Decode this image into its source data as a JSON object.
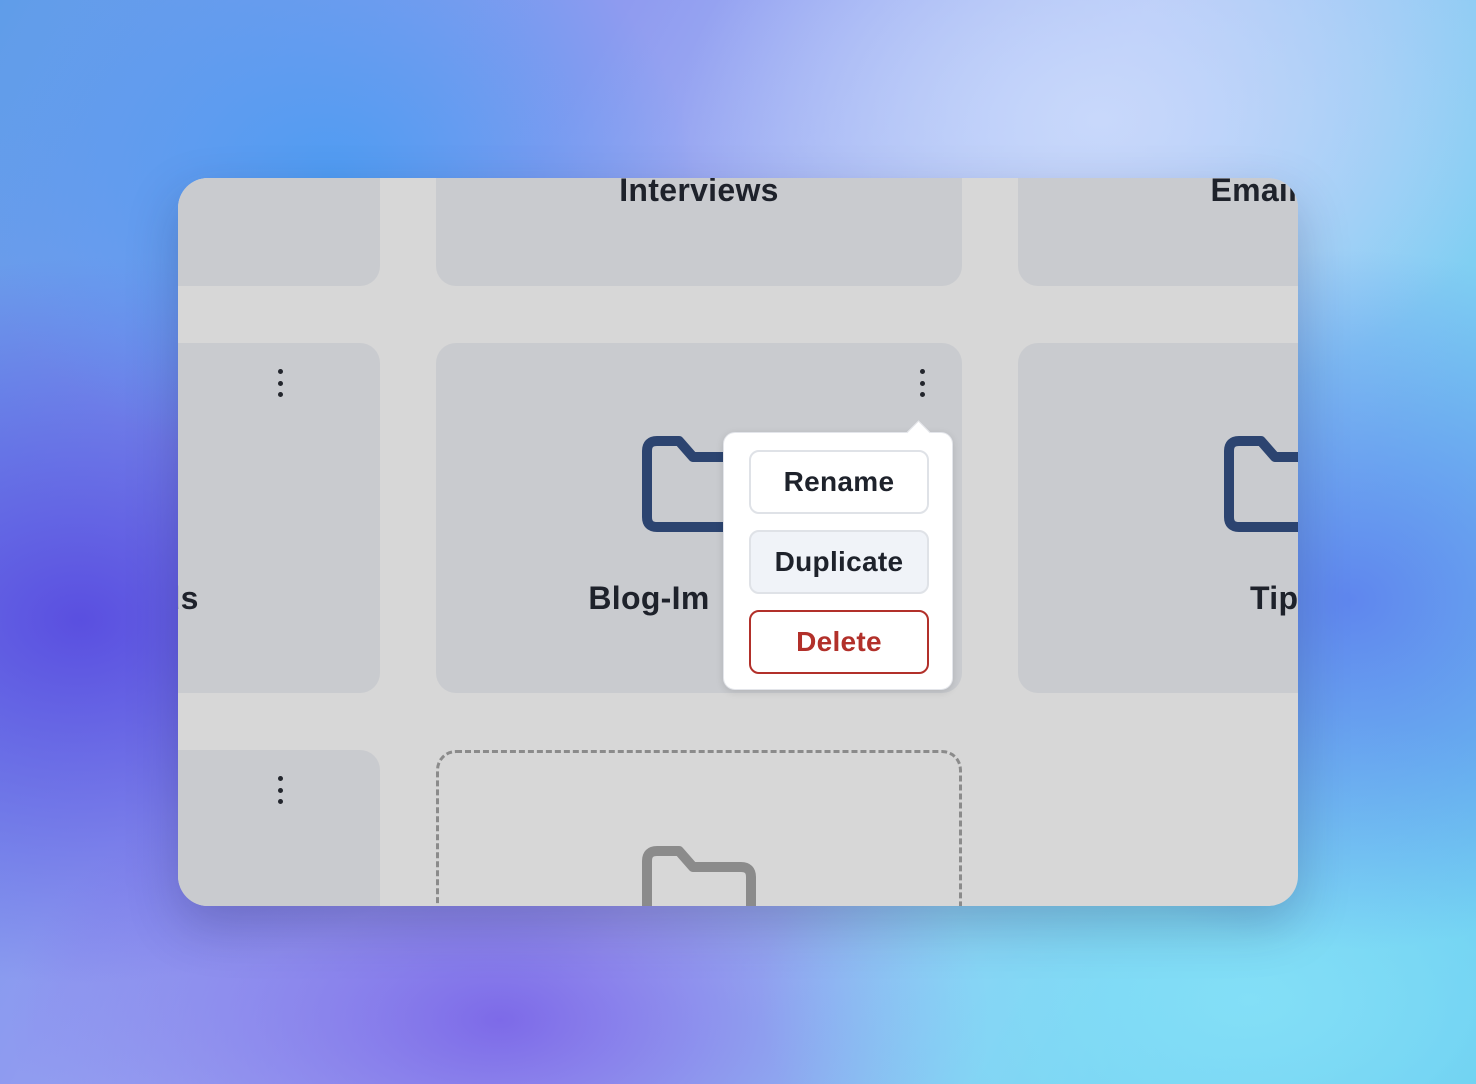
{
  "folders": {
    "top_row": [
      {
        "title": ""
      },
      {
        "title": "Interviews"
      },
      {
        "title": "Email Ma"
      }
    ],
    "middle_row": [
      {
        "title": "Ads"
      },
      {
        "title": "Blog-Im"
      },
      {
        "title": "Tip"
      }
    ]
  },
  "context_menu": {
    "rename_label": "Rename",
    "duplicate_label": "Duplicate",
    "delete_label": "Delete"
  },
  "colors": {
    "folder_icon": "#2c4470",
    "placeholder_folder_icon": "#8b8b8b",
    "delete_accent": "#b2302a",
    "card_background": "#c9cbcf",
    "canvas_background": "#d7d7d7"
  },
  "icons": {
    "card_menu": "more-vertical-icon",
    "folder": "folder-icon"
  }
}
